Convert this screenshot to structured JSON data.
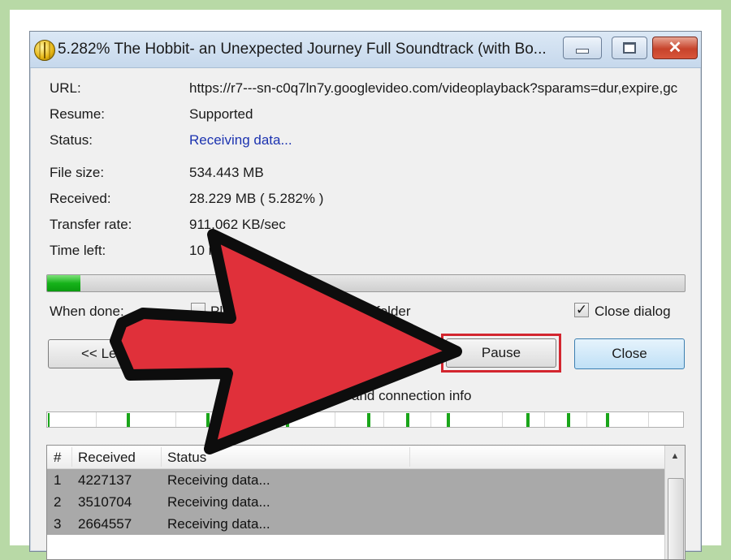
{
  "window": {
    "title": "5.282% The Hobbit- an Unexpected Journey Full Soundtrack (with Bo...",
    "min_label": "",
    "max_label": "",
    "close_glyph": "✕"
  },
  "info": {
    "url_label": "URL:",
    "url_value": "https://r7---sn-c0q7ln7y.googlevideo.com/videoplayback?sparams=dur,expire,gc",
    "resume_label": "Resume:",
    "resume_value": "Supported",
    "status_label": "Status:",
    "status_value": "Receiving data...",
    "filesize_label": "File size:",
    "filesize_value": "534.443 MB",
    "received_label": "Received:",
    "received_value": "28.229 MB ( 5.282% )",
    "rate_label": "Transfer rate:",
    "rate_value": "911.062 KB/sec",
    "timeleft_label": "Time left:",
    "timeleft_value": "10 m    sec"
  },
  "progress": {
    "percent": 5.282,
    "color": "#16b31a"
  },
  "options": {
    "when_done_label": "When done:",
    "play_label": "Play",
    "play_checked": false,
    "folder_label": "folder",
    "close_dialog_label": "Close dialog",
    "close_dialog_checked": true,
    "check_glyph": "✓"
  },
  "buttons": {
    "less_label": "<< Les",
    "pause_label": "Pause",
    "close_label": "Close"
  },
  "connection_info_label": "and connection info",
  "table": {
    "headers": [
      "#",
      "Received",
      "Status"
    ],
    "rows": [
      {
        "n": "1",
        "received": "4227137",
        "status": "Receiving data..."
      },
      {
        "n": "2",
        "received": "3510704",
        "status": "Receiving data..."
      },
      {
        "n": "3",
        "received": "2664557",
        "status": "Receiving data..."
      }
    ]
  },
  "colors": {
    "annotation_arrow": "#e0303a",
    "highlight_box": "#d3262f",
    "status_text": "#1c33b0"
  },
  "icons": {
    "app": "globe-download-icon",
    "scroll_up": "▲"
  }
}
